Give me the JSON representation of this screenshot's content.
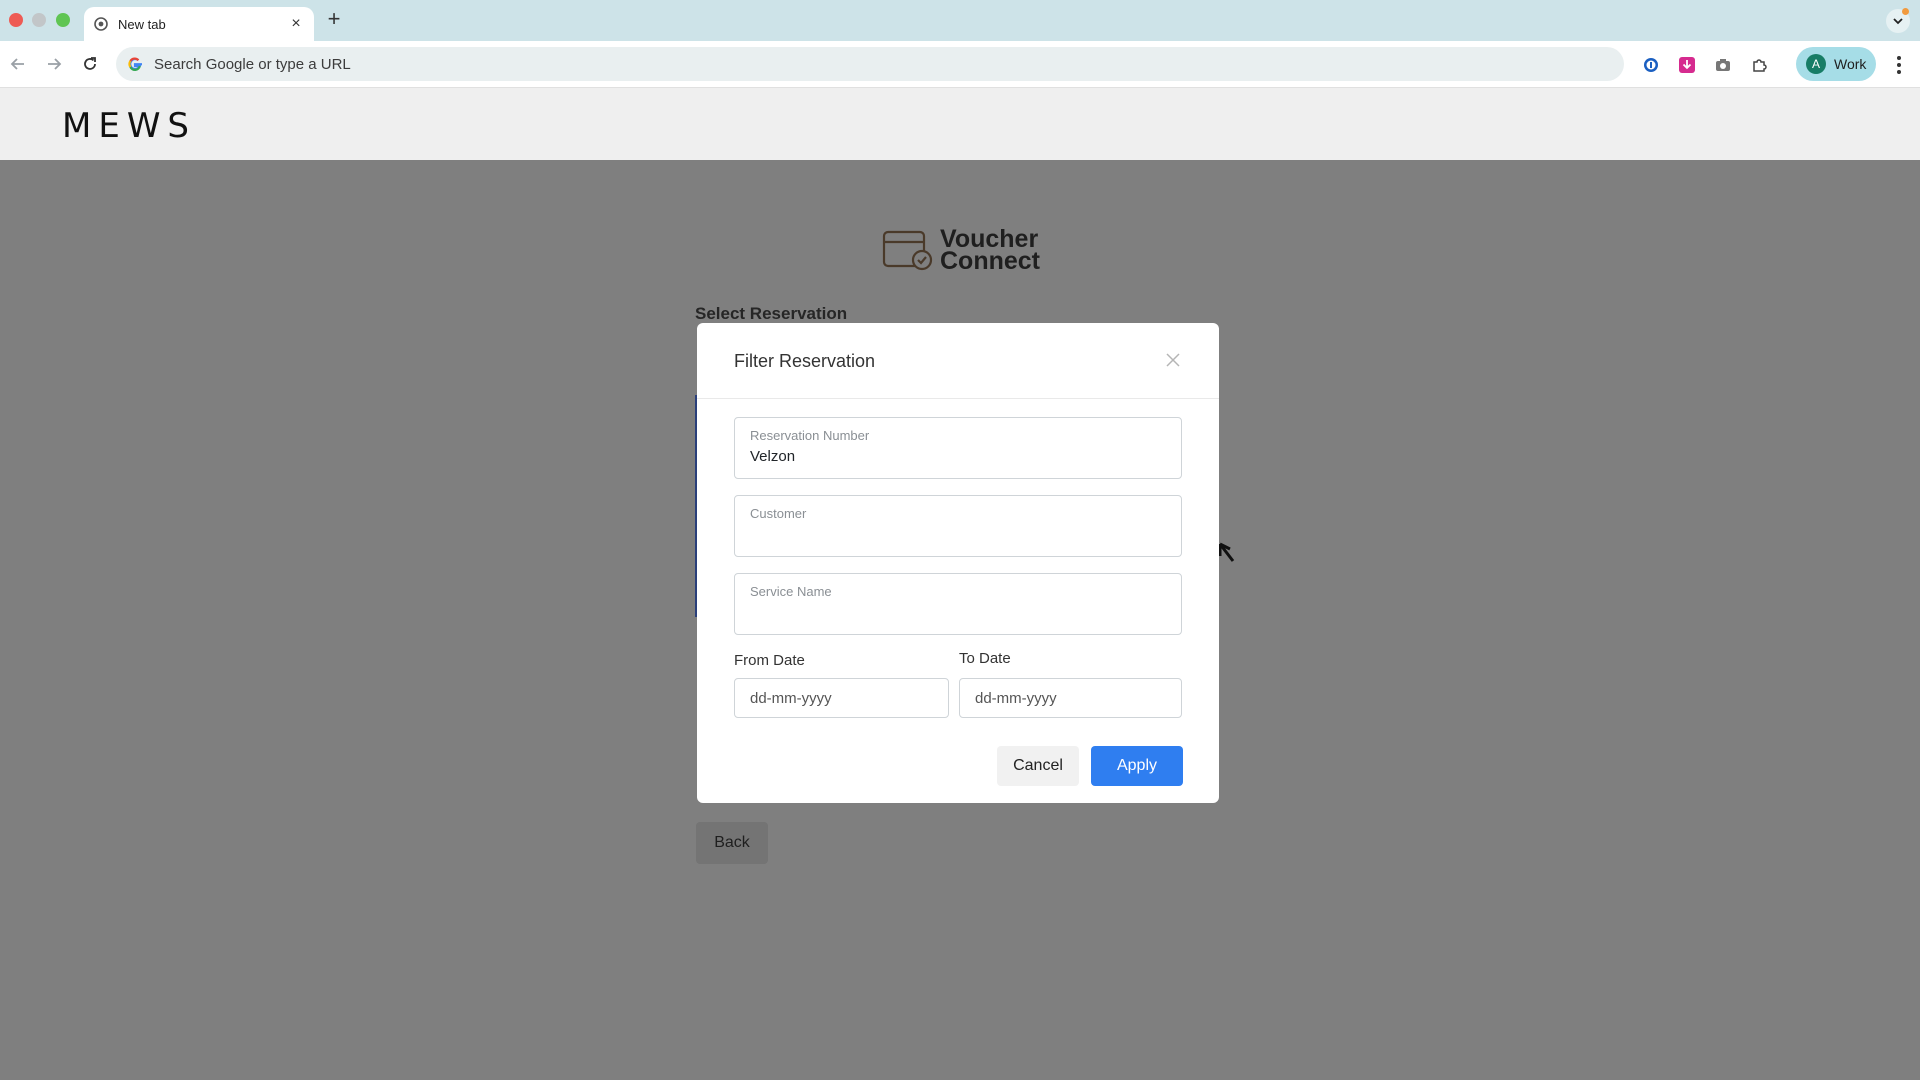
{
  "browser": {
    "tab_title": "New tab",
    "omnibox_placeholder": "Search Google or type a URL",
    "profile_initial": "A",
    "profile_name": "Work",
    "icons": [
      "back-icon",
      "forward-icon",
      "reload-icon",
      "google-icon",
      "password-manager-icon",
      "download-extension-icon",
      "camera-icon",
      "extensions-icon",
      "menu-icon"
    ]
  },
  "page": {
    "brand": "MEWS",
    "vc_logo_line1": "Voucher",
    "vc_logo_line2": "Connect",
    "section_title": "Select Reservation",
    "back_label": "Back"
  },
  "modal": {
    "title": "Filter Reservation",
    "fields": {
      "reservation_number": {
        "label": "Reservation Number",
        "value": "Velzon"
      },
      "customer": {
        "label": "Customer",
        "value": ""
      },
      "service_name": {
        "label": "Service Name",
        "value": ""
      }
    },
    "from_date": {
      "label": "From Date",
      "placeholder": "dd-mm-yyyy"
    },
    "to_date": {
      "label": "To Date",
      "placeholder": "dd-mm-yyyy"
    },
    "cancel_label": "Cancel",
    "apply_label": "Apply"
  },
  "colors": {
    "apply_button": "#2f7ef0",
    "backdrop": "#7f7f7f",
    "tabbar": "#cde3e8",
    "profile_chip": "#a6dde7"
  }
}
